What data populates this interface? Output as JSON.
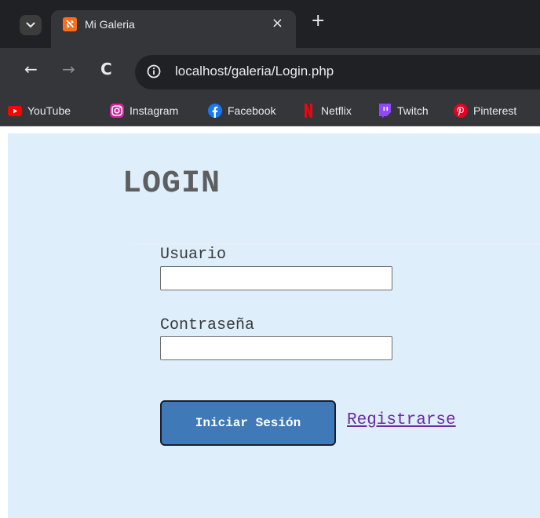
{
  "browser": {
    "tab": {
      "title": "Mi Galeria",
      "favicon": "xampp-icon",
      "close_glyph": "×"
    },
    "new_tab_glyph": "+",
    "toolbar": {
      "back_glyph": "←",
      "forward_glyph": "→",
      "reload_glyph": "C",
      "url": "localhost/galeria/Login.php"
    },
    "bookmarks": [
      {
        "label": "YouTube",
        "icon": "youtube-icon",
        "color": "#ff0000"
      },
      {
        "label": "Instagram",
        "icon": "instagram-icon",
        "color": "#d6249f"
      },
      {
        "label": "Facebook",
        "icon": "facebook-icon",
        "color": "#1877f2"
      },
      {
        "label": "Netflix",
        "icon": "netflix-icon",
        "color": "#e50914"
      },
      {
        "label": "Twitch",
        "icon": "twitch-icon",
        "color": "#9146ff"
      },
      {
        "label": "Pinterest",
        "icon": "pinterest-icon",
        "color": "#e60023"
      }
    ]
  },
  "page": {
    "background": "#deeefb",
    "title": "LOGIN",
    "form": {
      "username_label": "Usuario",
      "username_value": "",
      "password_label": "Contraseña",
      "password_value": "",
      "submit_label": "Iniciar Sesión",
      "register_link": "Registrarse"
    },
    "colors": {
      "button": "#4079b8",
      "link": "#6a2aa0",
      "title": "#5d5e5f"
    }
  }
}
